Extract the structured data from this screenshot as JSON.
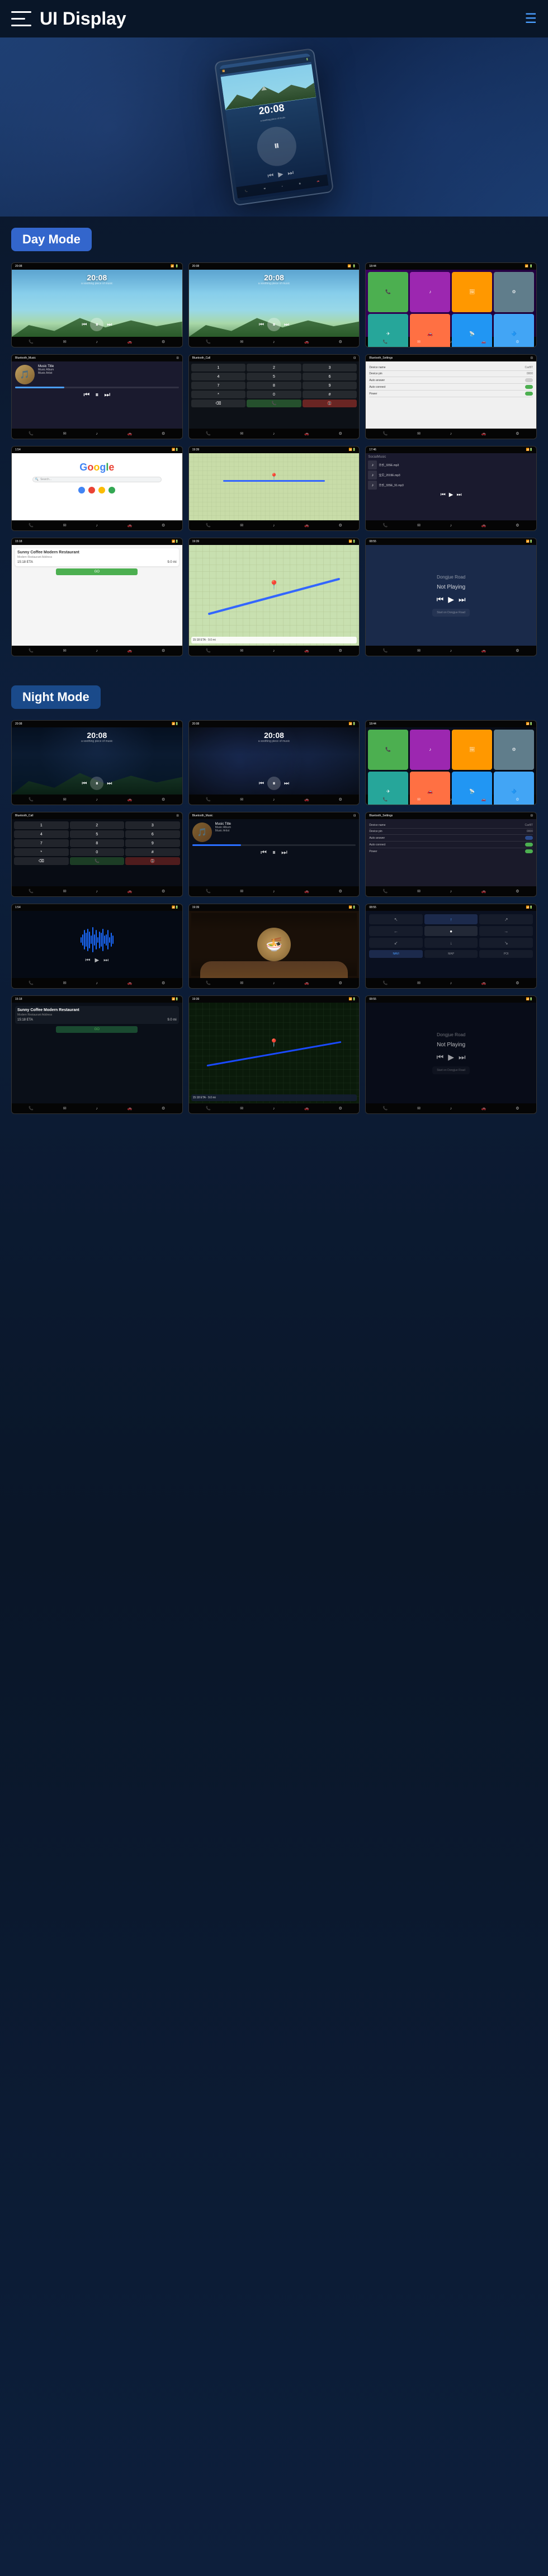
{
  "header": {
    "title": "UI Display",
    "menu_label": "menu",
    "nav_label": "navigation"
  },
  "day_mode": {
    "label": "Day Mode",
    "screens": [
      {
        "type": "media_day",
        "time": "20:08",
        "subtitle": "a soothing piece of music",
        "id": "day-media-1"
      },
      {
        "type": "media_day",
        "time": "20:08",
        "subtitle": "a soothing piece of music",
        "id": "day-media-2"
      },
      {
        "type": "app_grid",
        "id": "day-apps"
      },
      {
        "type": "bluetooth_music",
        "title": "Bluetooth_Music",
        "music_title": "Music Title",
        "music_album": "Music Album",
        "music_artist": "Music Artist",
        "id": "bt-music"
      },
      {
        "type": "bluetooth_call",
        "title": "Bluetooth_Call",
        "id": "bt-call"
      },
      {
        "type": "bluetooth_settings",
        "title": "Bluetooth_Settings",
        "device_name": "CarBT",
        "device_pin": "0000",
        "id": "bt-settings"
      },
      {
        "type": "google",
        "id": "google-screen"
      },
      {
        "type": "map_navigation",
        "id": "map-nav"
      },
      {
        "type": "social_music",
        "title": "SocialMusic",
        "id": "social-music"
      }
    ]
  },
  "large_screens_day": {
    "screens": [
      {
        "type": "coffee_nav",
        "name": "Sunny Coffee Modern Restaurant",
        "eta_label": "15:18 ETA",
        "distance": "9.0 mi",
        "id": "coffee-nav"
      },
      {
        "type": "large_map",
        "id": "large-map"
      },
      {
        "type": "not_playing",
        "label": "Not Playing",
        "road": "Dongjue Road",
        "id": "not-playing"
      }
    ]
  },
  "night_mode": {
    "label": "Night Mode",
    "screens": [
      {
        "type": "media_night",
        "time": "20:08",
        "id": "night-media-1"
      },
      {
        "type": "media_night",
        "time": "20:08",
        "id": "night-media-2"
      },
      {
        "type": "app_grid_night",
        "id": "night-apps"
      },
      {
        "type": "bluetooth_call_night",
        "title": "Bluetooth_Call",
        "id": "bt-call-night"
      },
      {
        "type": "bluetooth_music_night",
        "title": "Bluetooth_Music",
        "music_title": "Music Title",
        "music_album": "Music Album",
        "music_artist": "Music Artist",
        "id": "bt-music-night"
      },
      {
        "type": "bluetooth_settings_night",
        "title": "Bluetooth_Settings",
        "device_name": "CarBT",
        "device_pin": "0000",
        "id": "bt-settings-night"
      },
      {
        "type": "waveform_night",
        "id": "waveform-screen"
      },
      {
        "type": "food_screen",
        "id": "food-screen"
      },
      {
        "type": "night_nav",
        "id": "night-nav-screen"
      }
    ]
  },
  "large_screens_night": {
    "screens": [
      {
        "type": "coffee_nav_night",
        "name": "Sunny Coffee Modern Restaurant",
        "eta_label": "15:18 ETA",
        "distance": "9.0 mi",
        "id": "coffee-nav-night"
      },
      {
        "type": "large_map_night",
        "id": "large-map-night"
      },
      {
        "type": "not_playing_night",
        "label": "Not Playing",
        "road": "Dongjue Road",
        "id": "not-playing-night"
      }
    ]
  },
  "app_colors": {
    "phone": "#4CAF50",
    "message": "#2196F3",
    "maps": "#FF5722",
    "music": "#9C27B0",
    "settings": "#607D8B",
    "bluetooth": "#2196F3",
    "camera": "#FF9800",
    "podcast": "#FF9800",
    "youtube": "#F44336",
    "wifi": "#00BCD4"
  }
}
